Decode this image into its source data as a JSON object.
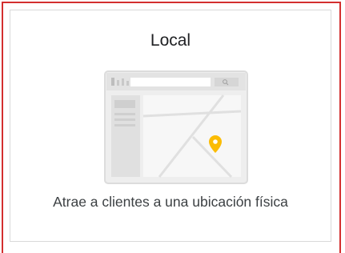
{
  "card": {
    "title": "Local",
    "description": "Atrae a clientes a una ubicación física",
    "illustration_icon": "local-map-browser-icon",
    "pin_color": "#fbbc04"
  }
}
